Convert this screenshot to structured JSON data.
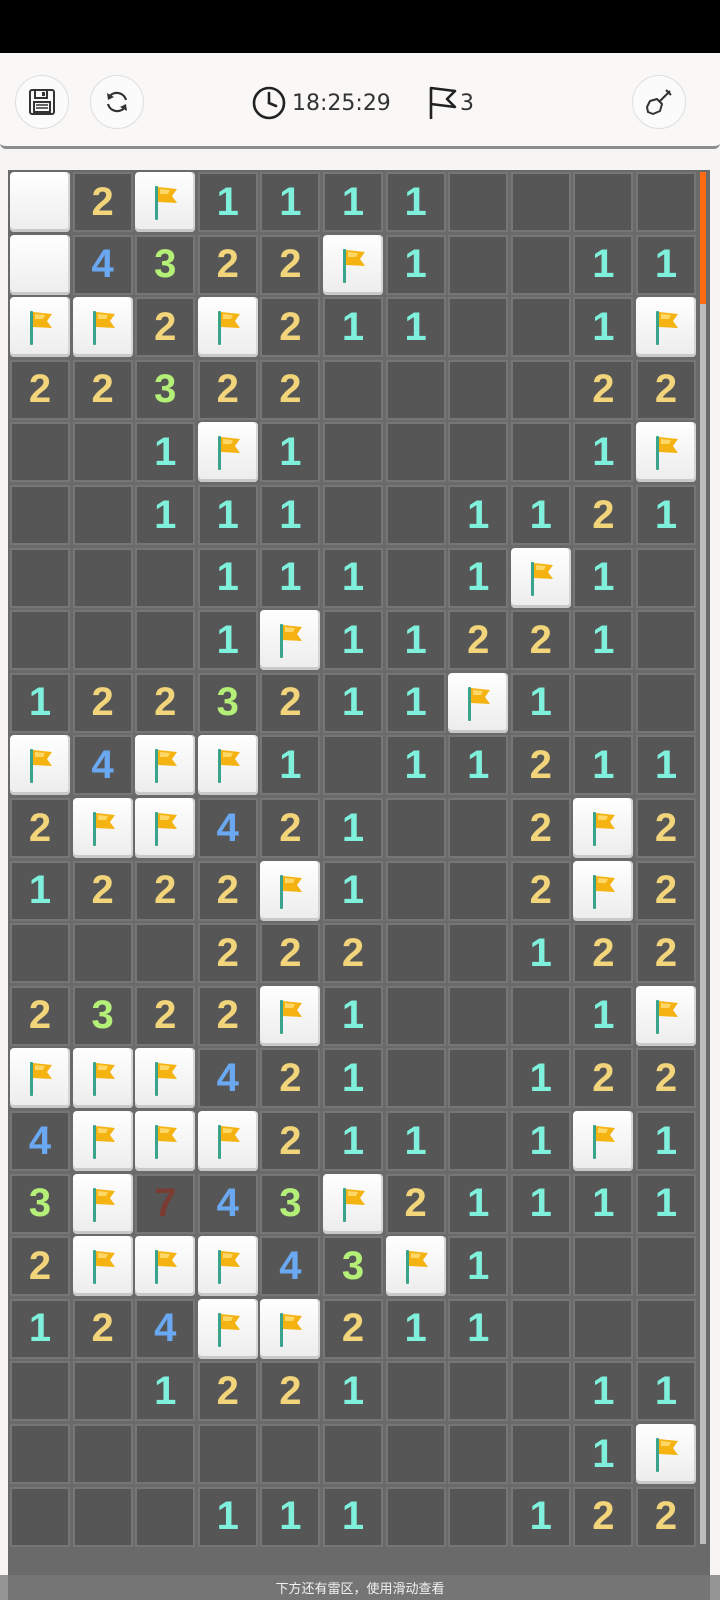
{
  "toolbar": {
    "save_icon": "save-icon",
    "restart_icon": "restart-icon",
    "timer": "18:25:29",
    "flags_left": "3",
    "shovel_icon": "shovel-icon"
  },
  "board": {
    "columns": 11,
    "legend": {
      "0": "open empty",
      "C": "covered",
      "F": "flag",
      "1-8": "revealed number"
    },
    "rows": [
      [
        "C",
        "2",
        "F",
        "1",
        "1",
        "1",
        "1",
        "0",
        "0",
        "0",
        "0"
      ],
      [
        "C",
        "4",
        "3",
        "2",
        "2",
        "F",
        "1",
        "0",
        "0",
        "1",
        "1"
      ],
      [
        "F",
        "F",
        "2",
        "F",
        "2",
        "1",
        "1",
        "0",
        "0",
        "1",
        "F"
      ],
      [
        "2",
        "2",
        "3",
        "2",
        "2",
        "0",
        "0",
        "0",
        "0",
        "2",
        "2"
      ],
      [
        "0",
        "0",
        "1",
        "F",
        "1",
        "0",
        "0",
        "0",
        "0",
        "1",
        "F"
      ],
      [
        "0",
        "0",
        "1",
        "1",
        "1",
        "0",
        "0",
        "1",
        "1",
        "2",
        "1"
      ],
      [
        "0",
        "0",
        "0",
        "1",
        "1",
        "1",
        "0",
        "1",
        "F",
        "1",
        "0"
      ],
      [
        "0",
        "0",
        "0",
        "1",
        "F",
        "1",
        "1",
        "2",
        "2",
        "1",
        "0"
      ],
      [
        "1",
        "2",
        "2",
        "3",
        "2",
        "1",
        "1",
        "F",
        "1",
        "0",
        "0"
      ],
      [
        "F",
        "4",
        "F",
        "F",
        "1",
        "0",
        "1",
        "1",
        "2",
        "1",
        "1"
      ],
      [
        "2",
        "F",
        "F",
        "4",
        "2",
        "1",
        "0",
        "0",
        "2",
        "F",
        "2"
      ],
      [
        "1",
        "2",
        "2",
        "2",
        "F",
        "1",
        "0",
        "0",
        "2",
        "F",
        "2"
      ],
      [
        "0",
        "0",
        "0",
        "2",
        "2",
        "2",
        "0",
        "0",
        "1",
        "2",
        "2"
      ],
      [
        "2",
        "3",
        "2",
        "2",
        "F",
        "1",
        "0",
        "0",
        "0",
        "1",
        "F"
      ],
      [
        "F",
        "F",
        "F",
        "4",
        "2",
        "1",
        "0",
        "0",
        "1",
        "2",
        "2"
      ],
      [
        "4",
        "F",
        "F",
        "F",
        "2",
        "1",
        "1",
        "0",
        "1",
        "F",
        "1"
      ],
      [
        "3",
        "F",
        "7",
        "4",
        "3",
        "F",
        "2",
        "1",
        "1",
        "1",
        "1"
      ],
      [
        "2",
        "F",
        "F",
        "F",
        "4",
        "3",
        "F",
        "1",
        "0",
        "0",
        "0"
      ],
      [
        "1",
        "2",
        "4",
        "F",
        "F",
        "2",
        "1",
        "1",
        "0",
        "0",
        "0"
      ],
      [
        "0",
        "0",
        "1",
        "2",
        "2",
        "1",
        "0",
        "0",
        "0",
        "1",
        "1"
      ],
      [
        "0",
        "0",
        "0",
        "0",
        "0",
        "0",
        "0",
        "0",
        "0",
        "1",
        "F"
      ],
      [
        "0",
        "0",
        "0",
        "1",
        "1",
        "1",
        "0",
        "0",
        "1",
        "2",
        "2"
      ]
    ],
    "number_colors": {
      "1": "#7ff0dc",
      "2": "#f2d47a",
      "3": "#b4ef78",
      "4": "#6aa8f2",
      "7": "#7a3b33"
    },
    "flag_color": "#f5b312",
    "pole_color": "#3aa38b"
  },
  "hint_text": "下方还有雷区，使用滑动查看"
}
